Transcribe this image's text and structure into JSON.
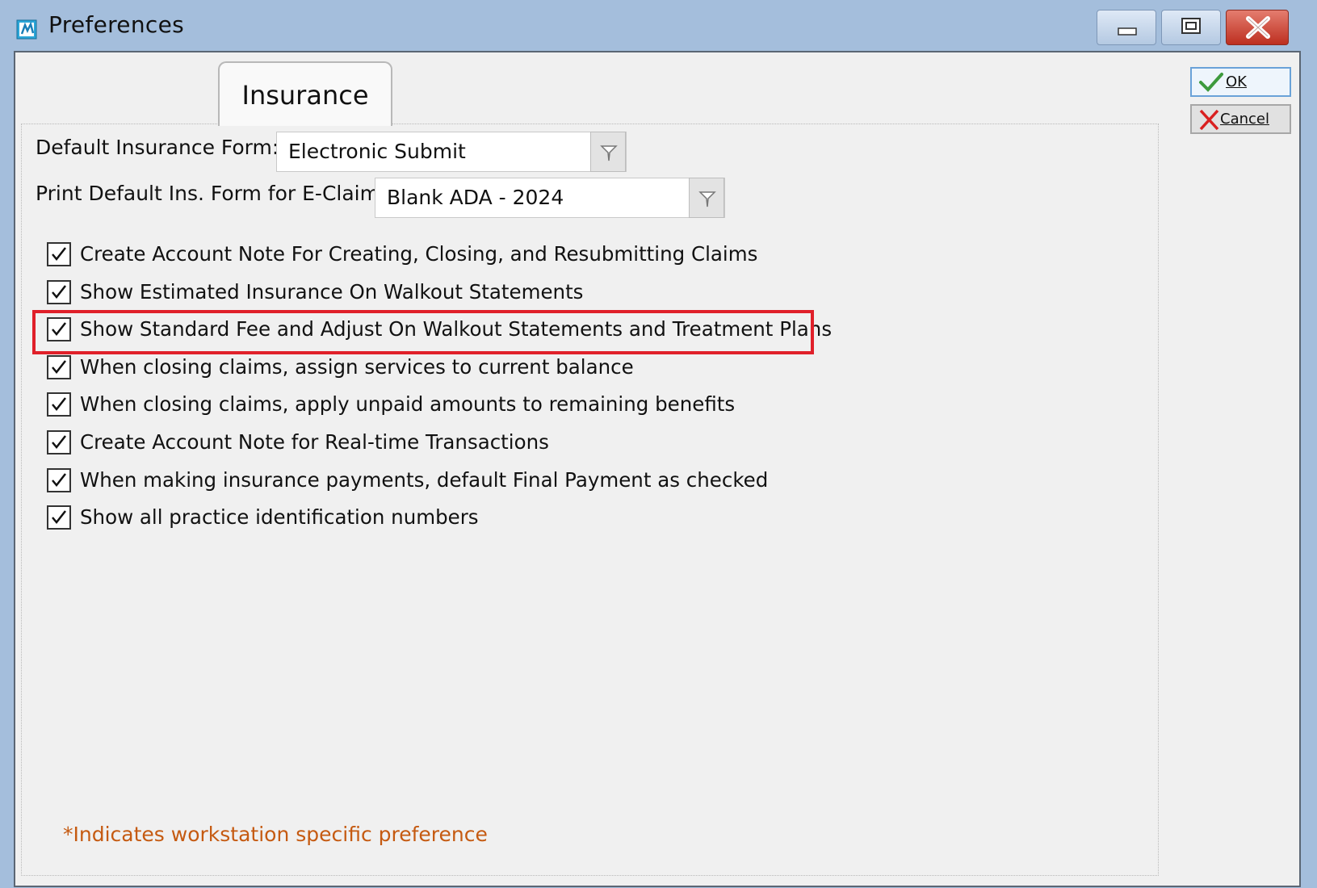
{
  "window": {
    "title": "Preferences",
    "controls": [
      "minimize",
      "maximize",
      "close"
    ]
  },
  "tab": {
    "label": "Insurance"
  },
  "fields": {
    "default_form_label": "Default Insurance Form:",
    "default_form_value": "Electronic Submit",
    "print_form_label": "Print Default Ins. Form for E-Claims:",
    "print_form_value": "Blank ADA - 2024"
  },
  "checkboxes": [
    {
      "label": "Create Account Note For Creating, Closing, and Resubmitting Claims",
      "checked": true
    },
    {
      "label": "Show Estimated Insurance On Walkout Statements",
      "checked": true
    },
    {
      "label": "Show Standard Fee and Adjust On Walkout Statements and Treatment Plans",
      "checked": true,
      "highlighted": true
    },
    {
      "label": "When closing claims, assign services to current balance",
      "checked": true
    },
    {
      "label": "When closing claims, apply unpaid amounts to remaining benefits",
      "checked": true
    },
    {
      "label": "Create Account Note for Real-time Transactions",
      "checked": true
    },
    {
      "label": "When making insurance payments, default Final Payment as checked",
      "checked": true
    },
    {
      "label": "Show all practice identification numbers",
      "checked": true
    }
  ],
  "footnote": "*Indicates workstation specific preference",
  "buttons": {
    "ok": "OK",
    "cancel": "Cancel"
  },
  "colors": {
    "highlight": "#e0202a",
    "footnote": "#c55a11",
    "ok_check": "#3d9a3d",
    "cancel_x": "#d92020"
  }
}
